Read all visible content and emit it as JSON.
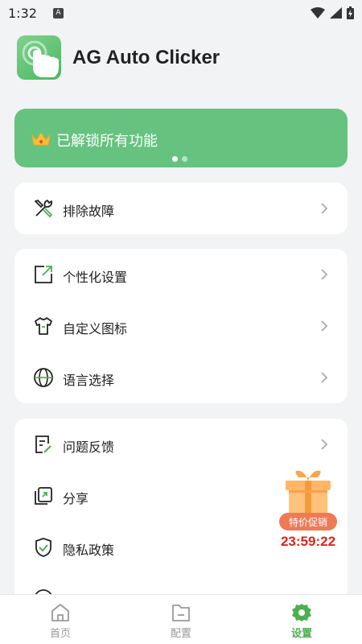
{
  "status_bar": {
    "time": "1:32",
    "notification_badge": "A"
  },
  "app": {
    "title": "AG Auto Clicker",
    "logo_icon": "tap-hand-icon"
  },
  "banner": {
    "text": "已解锁所有功能",
    "icon": "crown-icon",
    "page_count": 2,
    "active_page": 1
  },
  "card_troubleshoot": {
    "items": [
      {
        "label": "排除故障",
        "icon": "tools-icon"
      }
    ]
  },
  "card_personalize": {
    "items": [
      {
        "label": "个性化设置",
        "icon": "personalize-icon"
      },
      {
        "label": "自定义图标",
        "icon": "shirt-icon"
      },
      {
        "label": "语言选择",
        "icon": "globe-icon"
      }
    ]
  },
  "card_support": {
    "items": [
      {
        "label": "问题反馈",
        "icon": "feedback-icon"
      },
      {
        "label": "分享",
        "icon": "share-icon"
      },
      {
        "label": "隐私政策",
        "icon": "shield-check-icon"
      }
    ]
  },
  "promo": {
    "tag": "特价促销",
    "timer": "23:59:22",
    "icon": "gift-box-icon"
  },
  "bottom_nav": {
    "items": [
      {
        "label": "首页",
        "icon": "home-icon",
        "active": false
      },
      {
        "label": "配置",
        "icon": "folder-icon",
        "active": false
      },
      {
        "label": "设置",
        "icon": "gear-icon",
        "active": true
      }
    ]
  },
  "colors": {
    "accent": "#66c27f",
    "active_nav": "#4caf50",
    "timer": "#e2231a",
    "promo_tag": "#f07a56"
  }
}
